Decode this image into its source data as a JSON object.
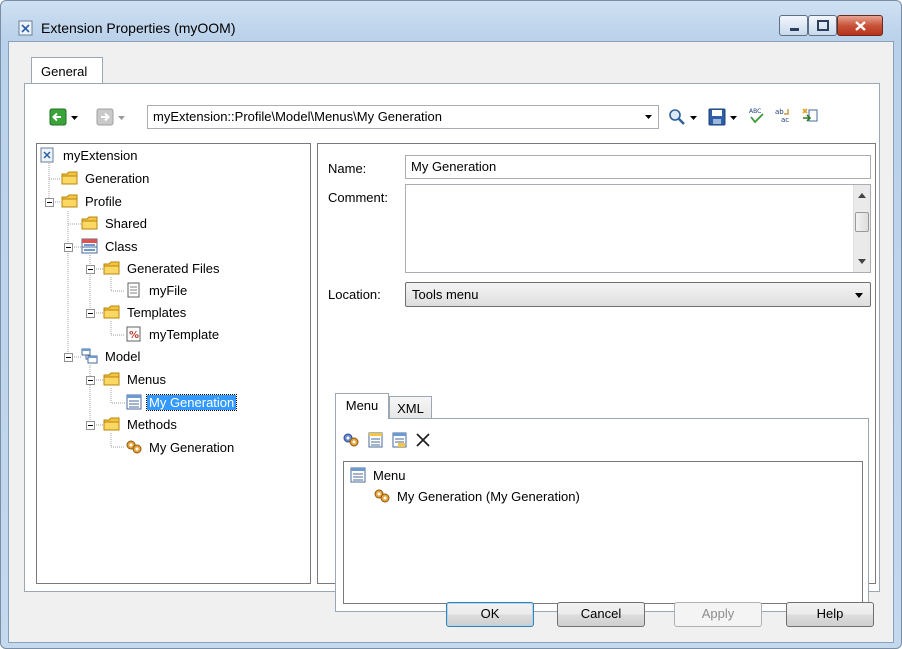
{
  "window": {
    "title": "Extension Properties (myOOM)"
  },
  "tabs": [
    {
      "label": "General",
      "active": true
    }
  ],
  "toolbar": {
    "path": "myExtension::Profile\\Model\\Menus\\My Generation",
    "icons": [
      "back-icon",
      "forward-icon",
      "find-icon",
      "save-icon",
      "spell-check-icon",
      "rename-icon",
      "export-icon"
    ]
  },
  "tree": {
    "items": [
      {
        "label": "myExtension",
        "icon": "extension-icon",
        "level": 0
      },
      {
        "label": "Generation",
        "icon": "folder-icon",
        "level": 1
      },
      {
        "label": "Profile",
        "icon": "folder-icon",
        "level": 1
      },
      {
        "label": "Shared",
        "icon": "folder-icon",
        "level": 2
      },
      {
        "label": "Class",
        "icon": "class-icon",
        "level": 2
      },
      {
        "label": "Generated Files",
        "icon": "folder-icon",
        "level": 3
      },
      {
        "label": "myFile",
        "icon": "file-icon",
        "level": 4
      },
      {
        "label": "Templates",
        "icon": "folder-icon",
        "level": 3
      },
      {
        "label": "myTemplate",
        "icon": "template-icon",
        "level": 4
      },
      {
        "label": "Model",
        "icon": "model-icon",
        "level": 2
      },
      {
        "label": "Menus",
        "icon": "folder-icon",
        "level": 3
      },
      {
        "label": "My Generation",
        "icon": "menu-icon",
        "level": 4,
        "selected": true
      },
      {
        "label": "Methods",
        "icon": "folder-icon",
        "level": 3
      },
      {
        "label": "My Generation",
        "icon": "method-icon",
        "level": 4
      }
    ]
  },
  "form": {
    "name_label": "Name:",
    "name_value": "My Generation",
    "comment_label": "Comment:",
    "comment_value": "",
    "location_label": "Location:",
    "location_value": "Tools menu"
  },
  "inner_tabs": [
    {
      "label": "Menu",
      "active": true
    },
    {
      "label": "XML",
      "active": false
    }
  ],
  "menu_tree": {
    "root": "Menu",
    "children": [
      "My Generation (My Generation)"
    ]
  },
  "buttons": {
    "ok": "OK",
    "cancel": "Cancel",
    "apply": "Apply",
    "help": "Help"
  },
  "colors": {
    "selection": "#3399ff",
    "folder": "#f5c542",
    "close_button": "#c8533a"
  }
}
